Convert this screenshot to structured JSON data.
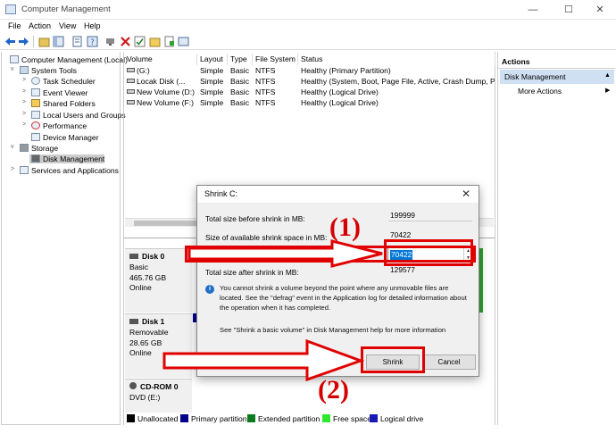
{
  "window": {
    "title": "Computer Management",
    "min": "—",
    "max": "☐",
    "close": "✕"
  },
  "menu": [
    "File",
    "Action",
    "View",
    "Help"
  ],
  "tree": {
    "root": "Computer Management (Local)",
    "system_tools": "System Tools",
    "task_scheduler": "Task Scheduler",
    "event_viewer": "Event Viewer",
    "shared_folders": "Shared Folders",
    "local_users": "Local Users and Groups",
    "performance": "Performance",
    "device_manager": "Device Manager",
    "storage": "Storage",
    "disk_management": "Disk Management",
    "services": "Services and Applications"
  },
  "volume_table": {
    "headers": [
      "Volume",
      "Layout",
      "Type",
      "File System",
      "Status"
    ],
    "rows": [
      {
        "volume": "(G:)",
        "layout": "Simple",
        "type": "Basic",
        "fs": "NTFS",
        "status": "Healthy (Primary Partition)"
      },
      {
        "volume": "Locak Disk (...",
        "layout": "Simple",
        "type": "Basic",
        "fs": "NTFS",
        "status": "Healthy (System, Boot, Page File, Active, Crash Dump, Prim"
      },
      {
        "volume": "New Volume (D:)",
        "layout": "Simple",
        "type": "Basic",
        "fs": "NTFS",
        "status": "Healthy (Logical Drive)"
      },
      {
        "volume": "New Volume (F:)",
        "layout": "Simple",
        "type": "Basic",
        "fs": "NTFS",
        "status": "Healthy (Logical Drive)"
      }
    ]
  },
  "disks": [
    {
      "name": "Disk 0",
      "type": "Basic",
      "size": "465.76 GB",
      "state": "Online"
    },
    {
      "name": "Disk 1",
      "type": "Removable",
      "size": "28.65 GB",
      "state": "Online"
    },
    {
      "name": "CD-ROM 0",
      "type": "DVD (E:)"
    }
  ],
  "legend": [
    {
      "label": "Unallocated",
      "color": "#000000"
    },
    {
      "label": "Primary partition",
      "color": "#00008b"
    },
    {
      "label": "Extended partition",
      "color": "#0a7a1e"
    },
    {
      "label": "Free space",
      "color": "#2ee82e"
    },
    {
      "label": "Logical drive",
      "color": "#1919b8"
    }
  ],
  "actions": {
    "header": "Actions",
    "section": "Disk Management",
    "more": "More Actions"
  },
  "dialog": {
    "title": "Shrink C:",
    "close": "✕",
    "total_before_label": "Total size before shrink in MB:",
    "total_before_value": "199999",
    "available_label": "Size of available shrink space in MB:",
    "available_value": "70422",
    "amount_label": "Enter the amount of space to shrink in MB:",
    "amount_value": "70422",
    "after_label": "Total size after shrink in MB:",
    "after_value": "129577",
    "note": "You cannot shrink a volume beyond the point where any unmovable files are located. See the \"defrag\" event in the Application log for detailed information about the operation when it has completed.",
    "help": "See \"Shrink a basic volume\" in Disk Management help for more information",
    "shrink_button": "Shrink",
    "cancel_button": "Cancel"
  },
  "annotations": {
    "step1": "(1)",
    "step2": "(2)",
    "color": "#e10000"
  }
}
